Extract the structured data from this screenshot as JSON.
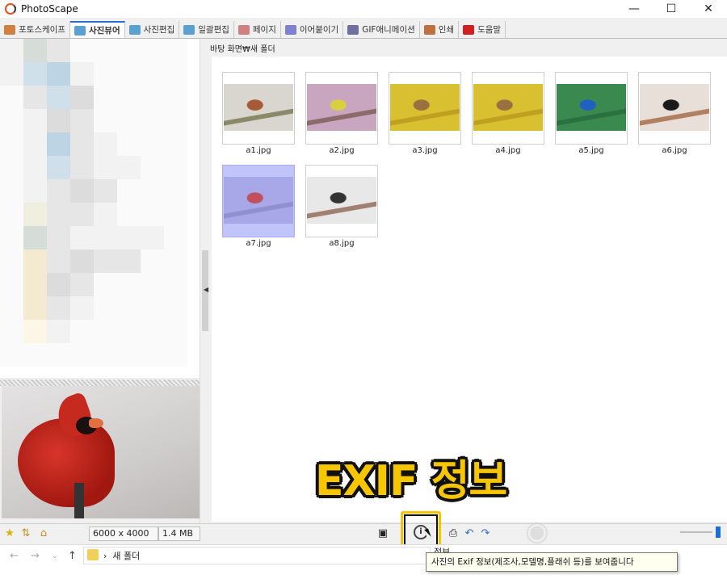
{
  "window": {
    "title": "PhotoScape",
    "controls": [
      "—",
      "☐",
      "✕"
    ]
  },
  "tabs": [
    {
      "label": "포토스케이프",
      "color": "#d08040"
    },
    {
      "label": "사진뷰어",
      "color": "#5aa0d0",
      "active": true
    },
    {
      "label": "사진편집",
      "color": "#5aa0d0"
    },
    {
      "label": "일괄편집",
      "color": "#5aa0d0"
    },
    {
      "label": "페이지",
      "color": "#d08080"
    },
    {
      "label": "이어붙이기",
      "color": "#8080d0"
    },
    {
      "label": "GIF애니메이션",
      "color": "#7070a0"
    },
    {
      "label": "인쇄",
      "color": "#c07040"
    },
    {
      "label": "도움말",
      "color": "#d02020"
    }
  ],
  "path": "바탕 화면₩새 폴더",
  "thumbnails": [
    {
      "file": "a1.jpg",
      "colors": [
        "#d9d6cf",
        "#a65a38",
        "#8a8a6a"
      ]
    },
    {
      "file": "a2.jpg",
      "colors": [
        "#c8a6c0",
        "#d8d040",
        "#8a6a6a"
      ]
    },
    {
      "file": "a3.jpg",
      "colors": [
        "#d8c030",
        "#9a7040",
        "#c0a020"
      ]
    },
    {
      "file": "a4.jpg",
      "colors": [
        "#d8c030",
        "#9a7040",
        "#c0a020"
      ]
    },
    {
      "file": "a5.jpg",
      "colors": [
        "#3a8a50",
        "#2060c0",
        "#2a7040"
      ]
    },
    {
      "file": "a6.jpg",
      "colors": [
        "#e8e0d8",
        "#1a1a1a",
        "#b08060"
      ]
    },
    {
      "file": "a7.jpg",
      "colors": [
        "#a8a8e8",
        "#c0505a",
        "#9090d0"
      ],
      "selected": true
    },
    {
      "file": "a8.jpg",
      "colors": [
        "#e8e8e8",
        "#333333",
        "#a08070"
      ]
    }
  ],
  "status": {
    "dimensions": "6000 x 4000",
    "size": "1.4 MB"
  },
  "banner": "EXIF 정보",
  "tooltip": "사진의 Exif 정보(제조사,모델명,플래쉬 등)를 보여줍니다",
  "tooltip_partial": "정보",
  "explorer": {
    "crumb": "새 폴더"
  },
  "colors": {
    "accent": "#f7c600",
    "highlight": "#1a6fd0"
  }
}
